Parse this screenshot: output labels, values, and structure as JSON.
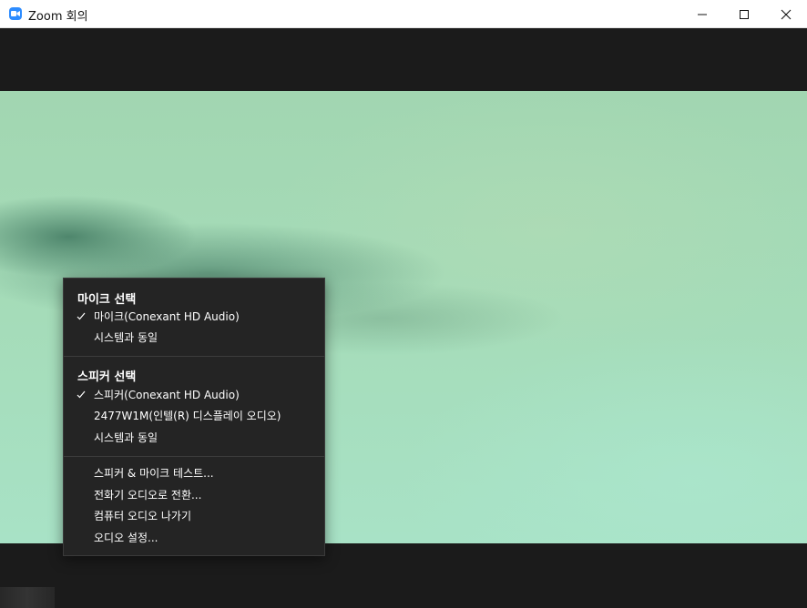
{
  "window": {
    "title": "Zoom 회의",
    "icon": "zoom-camera-icon"
  },
  "audio_menu": {
    "mic_section": {
      "header": "마이크 선택",
      "items": [
        {
          "label": "마이크(Conexant HD Audio)",
          "checked": true
        },
        {
          "label": "시스템과 동일",
          "checked": false
        }
      ]
    },
    "speaker_section": {
      "header": "스피커 선택",
      "items": [
        {
          "label": "스피커(Conexant HD Audio)",
          "checked": true
        },
        {
          "label": "2477W1M(인텔(R) 디스플레이 오디오)",
          "checked": false
        },
        {
          "label": "시스템과 동일",
          "checked": false
        }
      ]
    },
    "actions": [
      {
        "label": "스피커 & 마이크 테스트..."
      },
      {
        "label": "전화기 오디오로 전환..."
      },
      {
        "label": "컴퓨터 오디오 나가기"
      },
      {
        "label": "오디오 설정..."
      }
    ]
  },
  "colors": {
    "menu_bg": "#242424",
    "titlebar_bg": "#ffffff",
    "zoom_blue": "#2d8cff",
    "video_green": "#a5dcb9"
  }
}
